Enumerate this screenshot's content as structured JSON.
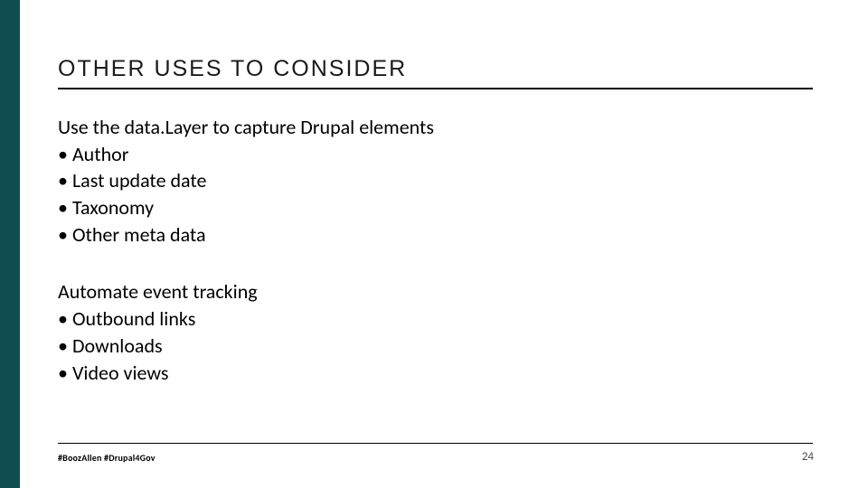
{
  "title": "OTHER USES TO CONSIDER",
  "sections": [
    {
      "lead": "Use the data.Layer to capture Drupal elements",
      "bullets": [
        "Author",
        "Last update date",
        "Taxonomy",
        "Other meta data"
      ]
    },
    {
      "lead": "Automate event tracking",
      "bullets": [
        "Outbound links",
        "Downloads",
        "Video views"
      ]
    }
  ],
  "footer": {
    "hashtags": "#BoozAllen #Drupal4Gov",
    "page_number": "24"
  },
  "colors": {
    "sidebar": "#0f4d50"
  }
}
